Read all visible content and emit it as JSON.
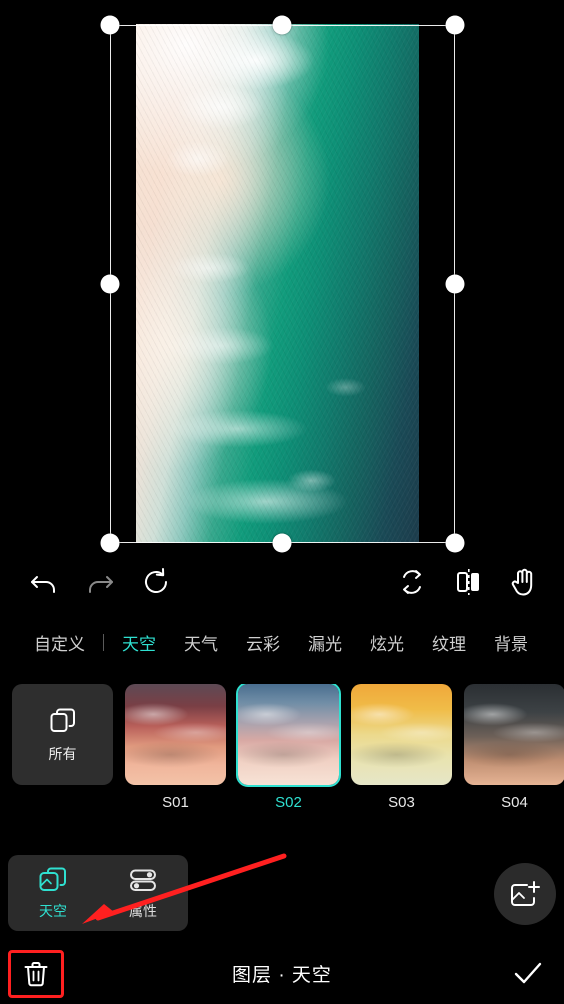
{
  "app": {
    "title": "图层 · 天空"
  },
  "canvas": {
    "image_name": "ocean-shoreline-photo",
    "selection_handles": 8
  },
  "transform_toolbar": {
    "items": [
      {
        "name": "undo-button",
        "icon": "undo-icon",
        "label": "撤销"
      },
      {
        "name": "redo-button",
        "icon": "redo-icon",
        "label": "重做"
      },
      {
        "name": "reset-button",
        "icon": "reset-icon",
        "label": "重置"
      },
      {
        "name": "flip-vertical-button",
        "icon": "flip-vertical-icon",
        "label": "垂直翻转"
      },
      {
        "name": "flip-horizontal-button",
        "icon": "flip-horizontal-icon",
        "label": "水平翻转"
      },
      {
        "name": "pan-button",
        "icon": "hand-icon",
        "label": "移动"
      }
    ]
  },
  "categories": {
    "items": [
      {
        "label": "自定义",
        "active": false
      },
      {
        "label": "天空",
        "active": true
      },
      {
        "label": "天气",
        "active": false
      },
      {
        "label": "云彩",
        "active": false
      },
      {
        "label": "漏光",
        "active": false
      },
      {
        "label": "炫光",
        "active": false
      },
      {
        "label": "纹理",
        "active": false
      },
      {
        "label": "背景",
        "active": false
      }
    ]
  },
  "presets": {
    "all_button": {
      "label": "所有",
      "icon": "copy-stack-icon"
    },
    "items": [
      {
        "label": "S01",
        "selected": false,
        "style": "t1"
      },
      {
        "label": "S02",
        "selected": true,
        "style": "t2"
      },
      {
        "label": "S03",
        "selected": false,
        "style": "t3"
      },
      {
        "label": "S04",
        "selected": false,
        "style": "t4"
      }
    ]
  },
  "layer_panel": {
    "items": [
      {
        "label": "天空",
        "icon": "layers-icon",
        "active": true
      },
      {
        "label": "属性",
        "icon": "sliders-icon",
        "active": false
      }
    ]
  },
  "add_layer_button": {
    "label": "",
    "icon": "add-image-icon"
  },
  "bottom_bar": {
    "title": "图层 · 天空",
    "delete_button": {
      "icon": "trash-icon",
      "label": ""
    },
    "confirm_button": {
      "icon": "check-icon",
      "label": ""
    }
  },
  "annotation": {
    "arrow_color": "#ff2020",
    "highlight_color": "#ff2020"
  },
  "colors": {
    "accent": "#2fe0d0",
    "background": "#000000",
    "panel": "#2b2b2b",
    "text": "#ffffff"
  }
}
